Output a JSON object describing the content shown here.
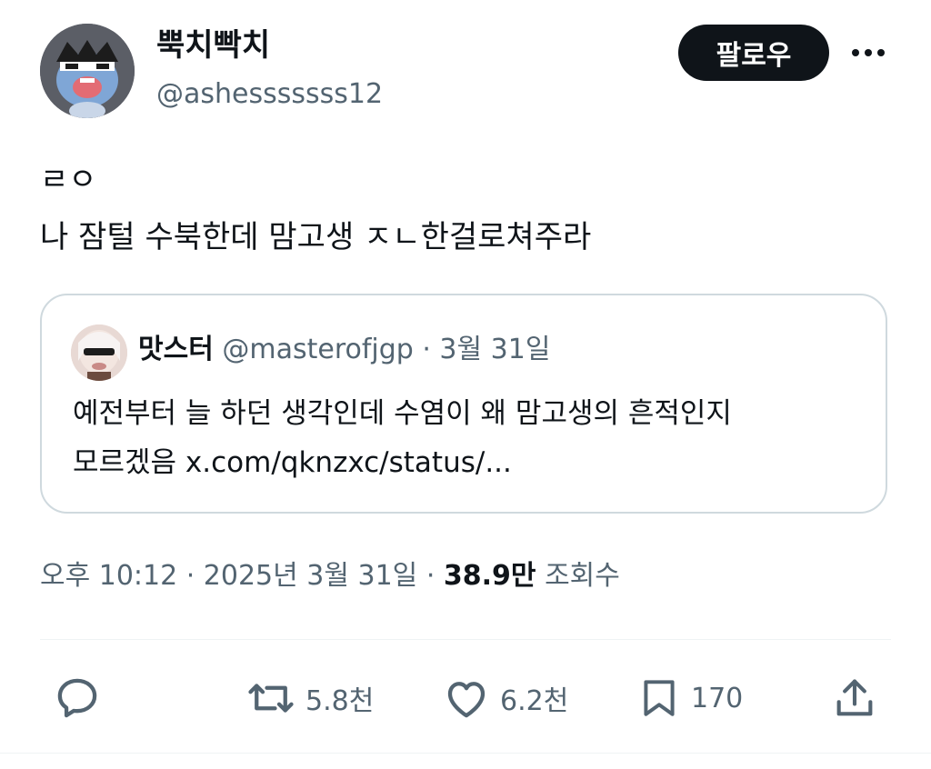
{
  "author": {
    "display_name": "뿍치빡치",
    "handle": "@ashesssssss12"
  },
  "follow_label": "팔로우",
  "tweet": {
    "lines": [
      "ㄹㅇ",
      "나 잠털 수북한데 맘고생 ㅈㄴ한걸로쳐주라"
    ]
  },
  "quote": {
    "display_name": "맛스터",
    "meta": "@masterofjgp · 3월 31일",
    "lines": [
      "예전부터 늘 하던 생각인데 수염이 왜 맘고생의 흔적인지",
      "모르겠음 x.com/qknzxc/status/..."
    ]
  },
  "timestamp": {
    "time": "오후 10:12 · 2025년 3월 31일 ·",
    "views_count": "38.9만",
    "views_label": "조회수"
  },
  "actions": {
    "reply_icon": "speech-bubble-icon",
    "retweet_count": "5.8천",
    "like_count": "6.2천",
    "bookmark_count": "170",
    "share_icon": "share-upload-icon"
  },
  "colors": {
    "text": "#0f1419",
    "secondary": "#536471",
    "border": "#cfd9de",
    "button_bg": "#0f1419"
  }
}
